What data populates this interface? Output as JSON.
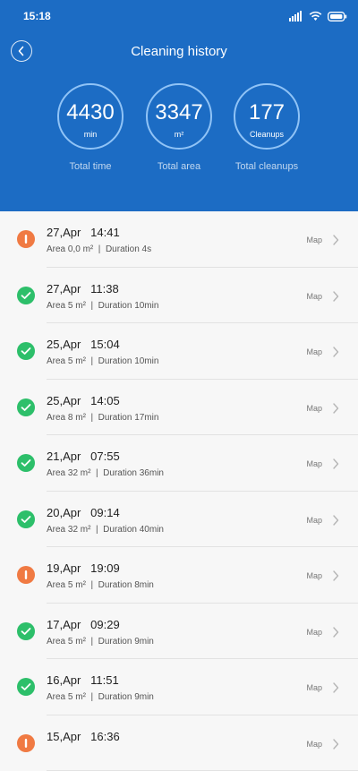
{
  "status_bar": {
    "time": "15:18"
  },
  "header": {
    "title": "Cleaning history"
  },
  "stats": [
    {
      "value": "4430",
      "unit": "min",
      "label": "Total time"
    },
    {
      "value": "3347",
      "unit": "m²",
      "label": "Total area"
    },
    {
      "value": "177",
      "unit": "Cleanups",
      "label": "Total cleanups"
    }
  ],
  "history": [
    {
      "status": "error",
      "title": "27,Apr   14:41",
      "detail": "Area 0,0 m²  |  Duration 4s",
      "action": "Map"
    },
    {
      "status": "ok",
      "title": "27,Apr   11:38",
      "detail": "Area 5 m²  |  Duration 10min",
      "action": "Map"
    },
    {
      "status": "ok",
      "title": "25,Apr   15:04",
      "detail": "Area 5 m²  |  Duration 10min",
      "action": "Map"
    },
    {
      "status": "ok",
      "title": "25,Apr   14:05",
      "detail": "Area 8 m²  |  Duration 17min",
      "action": "Map"
    },
    {
      "status": "ok",
      "title": "21,Apr   07:55",
      "detail": "Area 32 m²  |  Duration 36min",
      "action": "Map"
    },
    {
      "status": "ok",
      "title": "20,Apr   09:14",
      "detail": "Area 32 m²  |  Duration 40min",
      "action": "Map"
    },
    {
      "status": "error",
      "title": "19,Apr   19:09",
      "detail": "Area 5 m²  |  Duration 8min",
      "action": "Map"
    },
    {
      "status": "ok",
      "title": "17,Apr   09:29",
      "detail": "Area 5 m²  |  Duration 9min",
      "action": "Map"
    },
    {
      "status": "ok",
      "title": "16,Apr   11:51",
      "detail": "Area 5 m²  |  Duration 9min",
      "action": "Map"
    },
    {
      "status": "error",
      "title": "15,Apr   16:36",
      "detail": "",
      "action": "Map"
    }
  ],
  "colors": {
    "header_bg": "#1c6cc4",
    "ok": "#2dbf6a",
    "error": "#f07a43"
  }
}
